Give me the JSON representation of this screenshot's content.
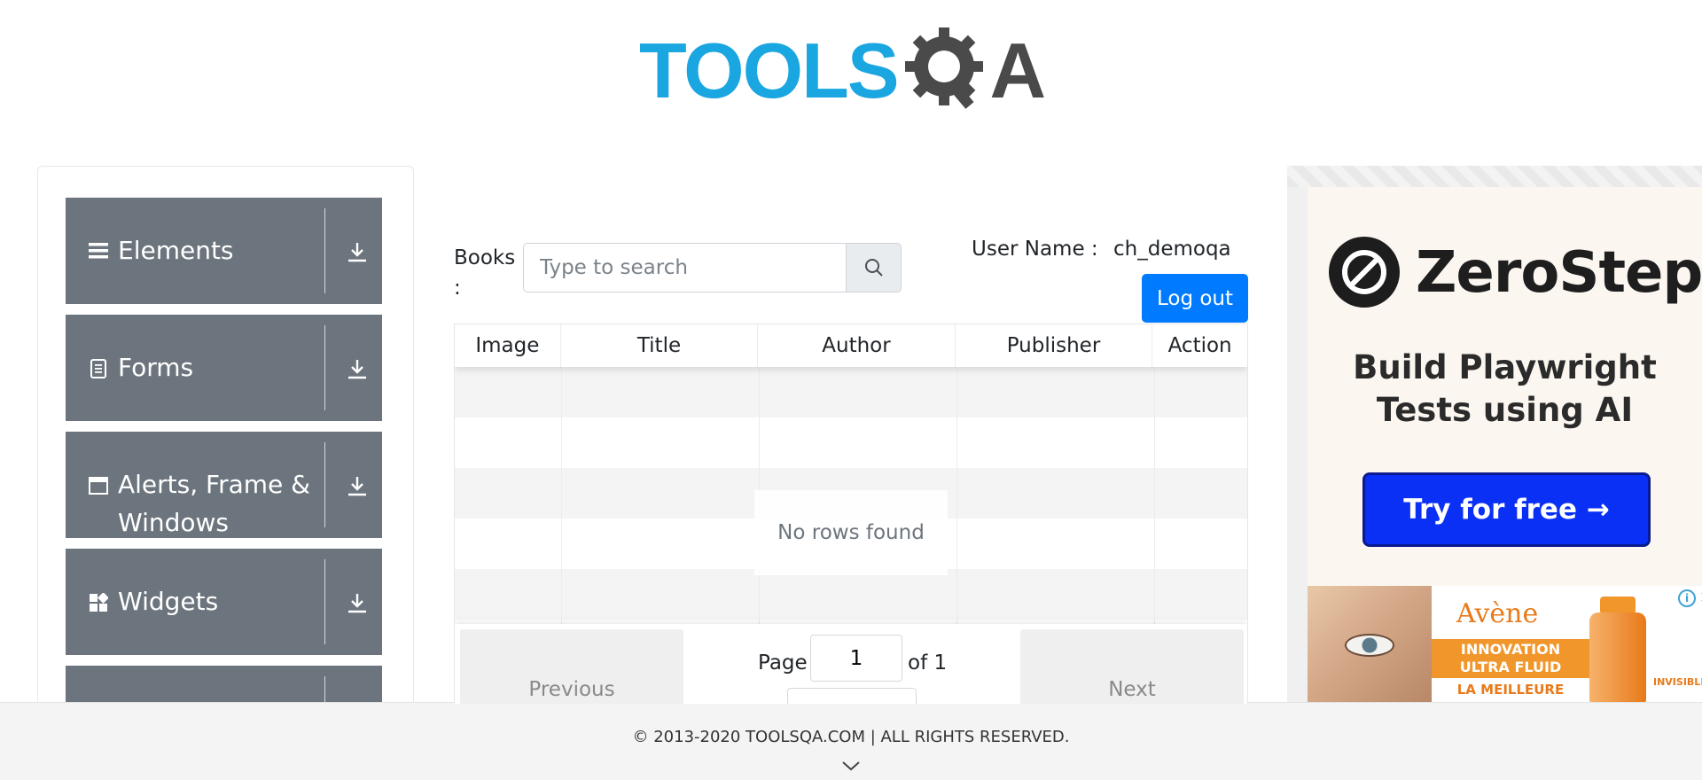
{
  "header": {
    "logo_tools": "TOOLS",
    "logo_a": "A"
  },
  "sidebar": {
    "groups": [
      {
        "label": "Elements",
        "icon": "hamburger-icon"
      },
      {
        "label": "Forms",
        "icon": "document-icon"
      },
      {
        "label_line1": "Alerts, Frame &",
        "label_line2": "Windows",
        "icon": "window-icon"
      },
      {
        "label": "Widgets",
        "icon": "widgets-icon"
      },
      {
        "label": "",
        "icon": ""
      }
    ]
  },
  "books": {
    "label": "Books :",
    "search_placeholder": "Type to search"
  },
  "user": {
    "label": "User Name :",
    "value": "ch_demoqa",
    "logout": "Log out"
  },
  "table": {
    "columns": [
      "Image",
      "Title",
      "Author",
      "Publisher",
      "Action"
    ],
    "empty_message": "No rows found",
    "pagination": {
      "previous": "Previous",
      "next": "Next",
      "page_label": "Page",
      "page_value": "1",
      "of_label": "of 1"
    }
  },
  "ad": {
    "brand": "ZeroStep",
    "headline_line1": "Build Playwright",
    "headline_line2": "Tests using AI",
    "cta": "Try for free →",
    "ad2_brand": "Avène",
    "ad2_band_line1": "INNOVATION",
    "ad2_band_line2": "ULTRA FLUID",
    "ad2_sub": "LA MEILLEURE",
    "ad2_tag": "INVISIBLE",
    "ad2_info": "i",
    "ad2_close": "✕"
  },
  "footer": {
    "text": "© 2013-2020 TOOLSQA.COM | ALL RIGHTS RESERVED."
  },
  "colors": {
    "accent": "#007bff",
    "sidebar_group": "#6c757d",
    "logo_blue": "#1aa6e0",
    "ad_cta": "#0a2ff5"
  }
}
